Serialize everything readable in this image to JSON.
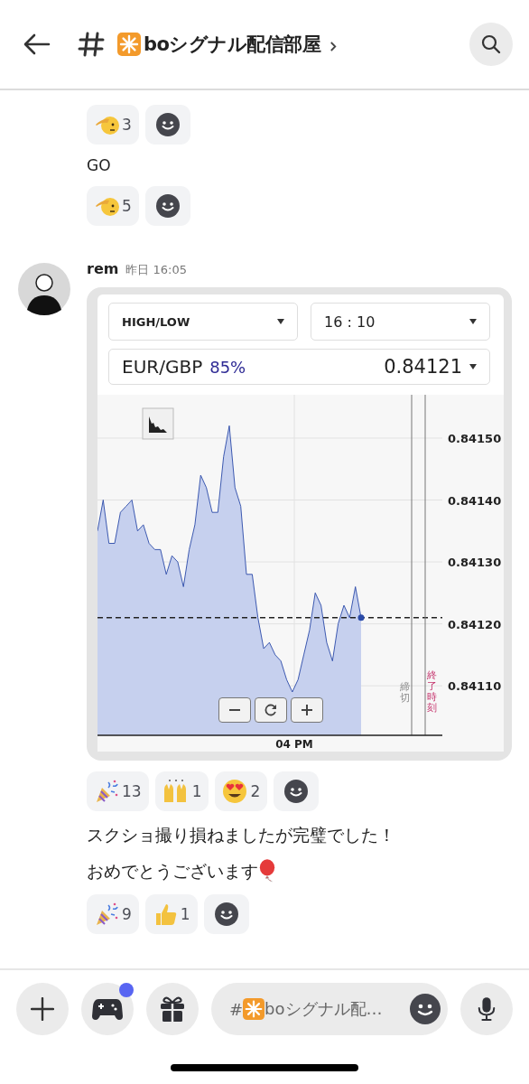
{
  "header": {
    "title": "boシグナル配信部屋"
  },
  "feed": [
    {
      "kind": "reactions",
      "reactions": [
        {
          "kind": "salute",
          "count": "3"
        }
      ]
    },
    {
      "kind": "text",
      "text": "GO"
    },
    {
      "kind": "reactions",
      "reactions": [
        {
          "kind": "salute",
          "count": "5"
        }
      ]
    },
    {
      "kind": "post",
      "author": "rem",
      "time": "昨日 16:05",
      "embed": {
        "trade_type": "HIGH/LOW",
        "expiry": "16 : 10",
        "pair": "EUR/GBP",
        "payout": "85%",
        "price": "0.84121",
        "time_label": "04 PM",
        "markers": [
          {
            "kind": "deadline",
            "label": "締切"
          },
          {
            "kind": "expiry",
            "label": "終了時刻"
          }
        ],
        "chart_data": {
          "type": "area",
          "ylim": [
            0.84102,
            0.84157
          ],
          "grid": true,
          "yticks": [
            {
              "value": 0.8411,
              "label": "0.84110"
            },
            {
              "value": 0.8412,
              "label": "0.84120"
            },
            {
              "value": 0.8413,
              "label": "0.84130"
            },
            {
              "value": 0.8414,
              "label": "0.84140"
            },
            {
              "value": 0.8415,
              "label": "0.84150"
            }
          ],
          "ref_lines": [
            {
              "axis": "y",
              "value": 0.84121
            }
          ],
          "series": [
            {
              "color": "#2a4aa8",
              "values": [
                0.84135,
                0.8414,
                0.84133,
                0.84133,
                0.84138,
                0.84139,
                0.8414,
                0.84135,
                0.84136,
                0.84133,
                0.84132,
                0.84132,
                0.84128,
                0.84131,
                0.8413,
                0.84126,
                0.84132,
                0.84136,
                0.84144,
                0.84142,
                0.84138,
                0.84138,
                0.84147,
                0.84152,
                0.84142,
                0.84139,
                0.84128,
                0.84128,
                0.84121,
                0.84116,
                0.84117,
                0.84115,
                0.84114,
                0.84111,
                0.84109,
                0.84111,
                0.84115,
                0.84119,
                0.84125,
                0.84123,
                0.84117,
                0.84114,
                0.8412,
                0.84123,
                0.84121,
                0.84126,
                0.84121
              ]
            }
          ]
        }
      }
    },
    {
      "kind": "reactions",
      "reactions": [
        {
          "kind": "party",
          "count": "13"
        },
        {
          "kind": "raised-hands",
          "count": "1"
        },
        {
          "kind": "heart-eyes",
          "count": "2"
        }
      ]
    },
    {
      "kind": "text",
      "text": "スクショ撮り損ねましたが完璧でした！"
    },
    {
      "kind": "text",
      "text": "おめでとうございます",
      "icons": [
        {
          "kind": "balloon"
        }
      ]
    },
    {
      "kind": "reactions",
      "reactions": [
        {
          "kind": "party",
          "count": "9"
        },
        {
          "kind": "thumbs-up",
          "count": "1"
        }
      ]
    }
  ],
  "composer": {
    "prefix": "#",
    "placeholder": "boシグナル配…",
    "game_notification": true
  }
}
